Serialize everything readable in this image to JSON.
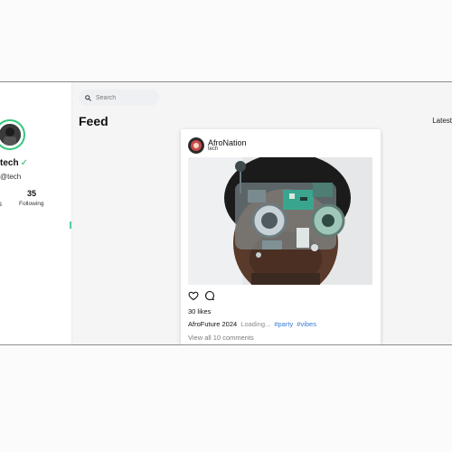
{
  "sidebar": {
    "profile_name": "tech",
    "verified_icon": "✓",
    "handle": "@tech",
    "left_stat_label": "s",
    "following_count": "35",
    "following_label": "Following"
  },
  "search": {
    "placeholder": "Search"
  },
  "feed": {
    "title": "Feed",
    "sort_label": "Latest"
  },
  "post": {
    "author": "AfroNation",
    "category": "tech",
    "likes": "30 likes",
    "caption_title": "AfroFuture 2024",
    "caption_text": "Loading...",
    "hashtags": [
      "#party",
      "#vibes"
    ],
    "comments_link": "View all 10 comments"
  },
  "colors": {
    "accent_green": "#34c77b",
    "link_blue": "#3a7bd5"
  }
}
